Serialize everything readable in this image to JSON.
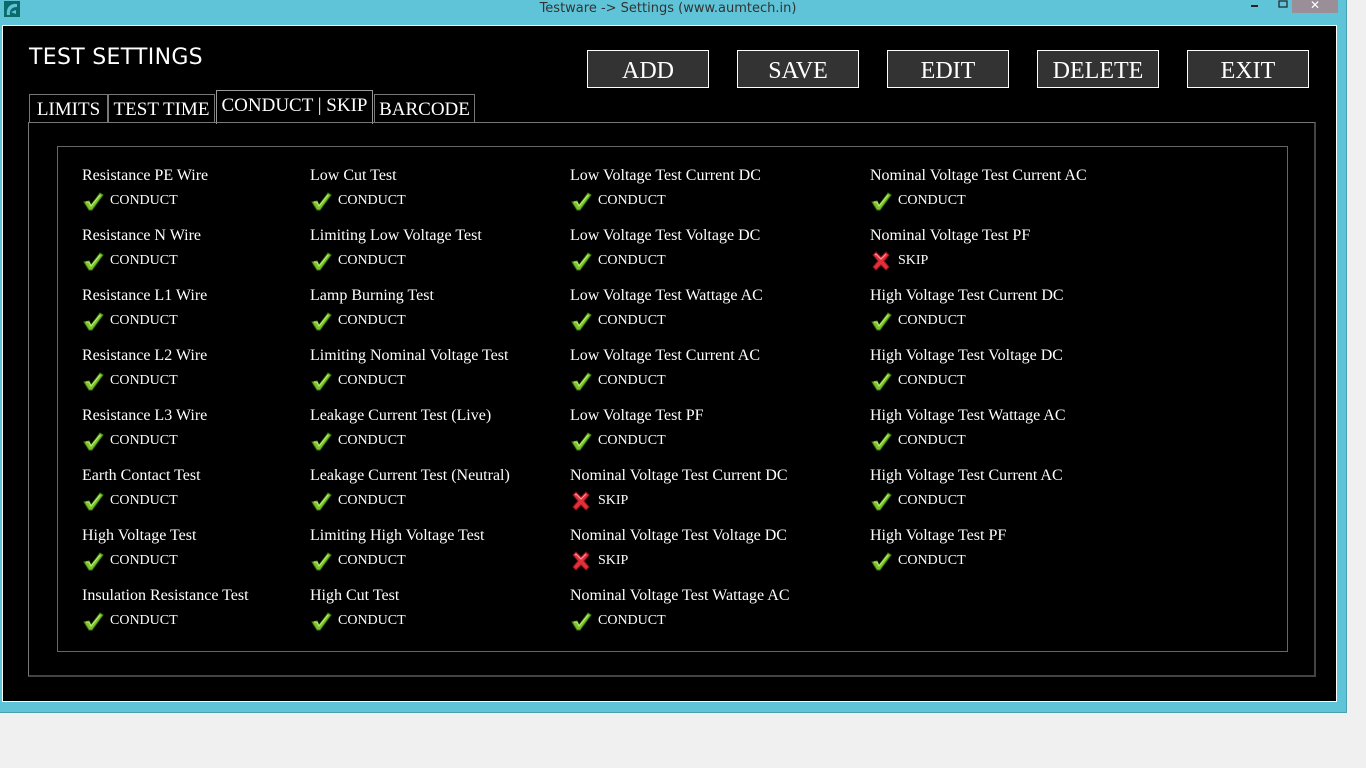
{
  "window": {
    "title": "Testware -> Settings (www.aumtech.in)",
    "controls": {
      "minimize": "—",
      "maximize": "□",
      "close": "✕"
    }
  },
  "page": {
    "title": "TEST SETTINGS"
  },
  "toolbar": {
    "add_label": "ADD",
    "save_label": "SAVE",
    "edit_label": "EDIT",
    "delete_label": "DELETE",
    "exit_label": "EXIT"
  },
  "tabs": [
    {
      "label": "LIMITS",
      "active": false
    },
    {
      "label": "TEST TIME",
      "active": false
    },
    {
      "label": "CONDUCT | SKIP",
      "active": true
    },
    {
      "label": "BARCODE",
      "active": false
    }
  ],
  "status_labels": {
    "conduct": "CONDUCT",
    "skip": "SKIP"
  },
  "colors": {
    "check": "#7cc52a",
    "cross": "#e0303a",
    "titlebar": "#5fc4d8"
  },
  "columns": [
    [
      {
        "name": "Resistance PE Wire",
        "status": "CONDUCT"
      },
      {
        "name": "Resistance N Wire",
        "status": "CONDUCT"
      },
      {
        "name": "Resistance L1 Wire",
        "status": "CONDUCT"
      },
      {
        "name": "Resistance L2 Wire",
        "status": "CONDUCT"
      },
      {
        "name": "Resistance L3 Wire",
        "status": "CONDUCT"
      },
      {
        "name": "Earth Contact Test",
        "status": "CONDUCT"
      },
      {
        "name": "High Voltage Test",
        "status": "CONDUCT"
      },
      {
        "name": "Insulation Resistance Test",
        "status": "CONDUCT"
      }
    ],
    [
      {
        "name": "Low Cut Test",
        "status": "CONDUCT"
      },
      {
        "name": "Limiting Low Voltage Test",
        "status": "CONDUCT"
      },
      {
        "name": "Lamp Burning Test",
        "status": "CONDUCT"
      },
      {
        "name": "Limiting Nominal Voltage Test",
        "status": "CONDUCT"
      },
      {
        "name": "Leakage Current Test (Live)",
        "status": "CONDUCT"
      },
      {
        "name": "Leakage Current Test (Neutral)",
        "status": "CONDUCT"
      },
      {
        "name": "Limiting High Voltage Test",
        "status": "CONDUCT"
      },
      {
        "name": "High Cut Test",
        "status": "CONDUCT"
      }
    ],
    [
      {
        "name": "Low Voltage Test Current DC",
        "status": "CONDUCT"
      },
      {
        "name": "Low Voltage Test Voltage DC",
        "status": "CONDUCT"
      },
      {
        "name": "Low Voltage Test Wattage AC",
        "status": "CONDUCT"
      },
      {
        "name": "Low Voltage Test Current AC",
        "status": "CONDUCT"
      },
      {
        "name": "Low Voltage Test PF",
        "status": "CONDUCT"
      },
      {
        "name": "Nominal Voltage Test Current DC",
        "status": "SKIP"
      },
      {
        "name": "Nominal Voltage Test Voltage DC",
        "status": "SKIP"
      },
      {
        "name": "Nominal Voltage Test Wattage AC",
        "status": "CONDUCT"
      }
    ],
    [
      {
        "name": "Nominal Voltage Test Current AC",
        "status": "CONDUCT"
      },
      {
        "name": "Nominal Voltage Test PF",
        "status": "SKIP"
      },
      {
        "name": "High Voltage Test Current DC",
        "status": "CONDUCT"
      },
      {
        "name": "High Voltage Test Voltage DC",
        "status": "CONDUCT"
      },
      {
        "name": "High Voltage Test Wattage AC",
        "status": "CONDUCT"
      },
      {
        "name": "High Voltage Test Current AC",
        "status": "CONDUCT"
      },
      {
        "name": "High Voltage Test PF",
        "status": "CONDUCT"
      }
    ]
  ]
}
